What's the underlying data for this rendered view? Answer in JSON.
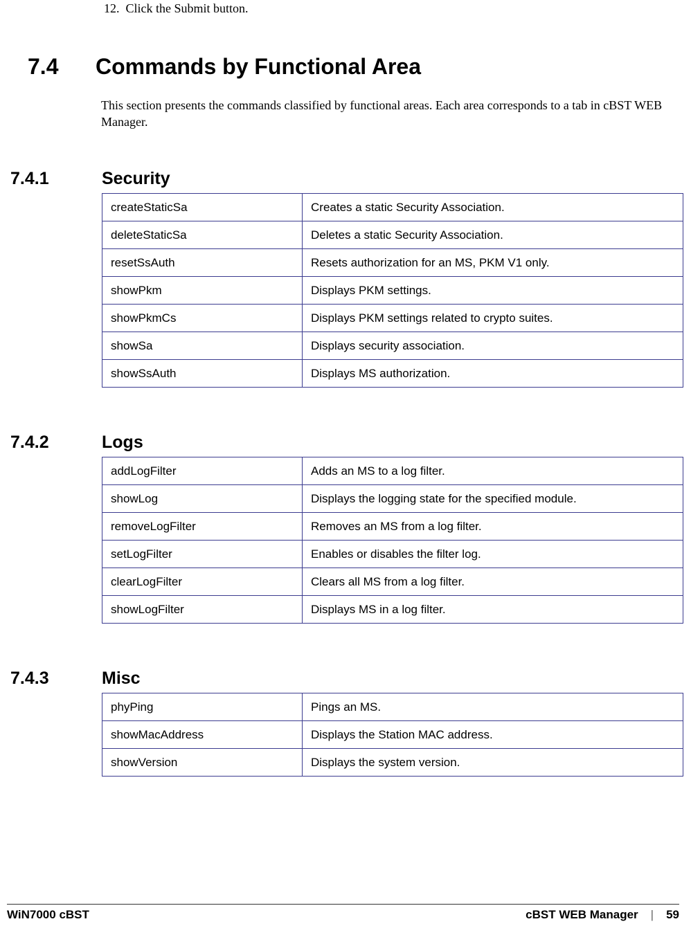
{
  "top_list": {
    "number": "12.",
    "text": "Click the Submit button."
  },
  "main": {
    "number": "7.4",
    "title": "Commands by Functional Area",
    "intro": "This section presents the commands classified by functional areas. Each area corresponds to a tab in cBST WEB Manager."
  },
  "sections": [
    {
      "number": "7.4.1",
      "title": "Security",
      "rows": [
        {
          "cmd": "createStaticSa",
          "desc": "Creates a static Security Association."
        },
        {
          "cmd": "deleteStaticSa",
          "desc": "Deletes a static Security Association."
        },
        {
          "cmd": "resetSsAuth",
          "desc": "Resets authorization for an MS, PKM V1 only."
        },
        {
          "cmd": "showPkm",
          "desc": "Displays PKM settings."
        },
        {
          "cmd": "showPkmCs",
          "desc": "Displays PKM settings related to crypto suites."
        },
        {
          "cmd": "showSa",
          "desc": "Displays security association."
        },
        {
          "cmd": "showSsAuth",
          "desc": "Displays MS authorization."
        }
      ]
    },
    {
      "number": "7.4.2",
      "title": "Logs",
      "rows": [
        {
          "cmd": "addLogFilter",
          "desc": "Adds an MS to a log filter."
        },
        {
          "cmd": "showLog",
          "desc": "Displays the logging state for the specified module."
        },
        {
          "cmd": "removeLogFilter",
          "desc": "Removes an MS from a log filter."
        },
        {
          "cmd": "setLogFilter",
          "desc": "Enables or disables the filter log."
        },
        {
          "cmd": "clearLogFilter",
          "desc": "Clears all MS from a log filter."
        },
        {
          "cmd": "showLogFilter",
          "desc": "Displays MS in a log filter."
        }
      ]
    },
    {
      "number": "7.4.3",
      "title": "Misc",
      "rows": [
        {
          "cmd": "phyPing",
          "desc": "Pings an MS."
        },
        {
          "cmd": "showMacAddress",
          "desc": "Displays the Station MAC address."
        },
        {
          "cmd": "showVersion",
          "desc": "Displays the system version."
        }
      ]
    }
  ],
  "footer": {
    "left": "WiN7000 cBST",
    "right_label": "cBST WEB Manager",
    "divider": "|",
    "page": "59"
  }
}
